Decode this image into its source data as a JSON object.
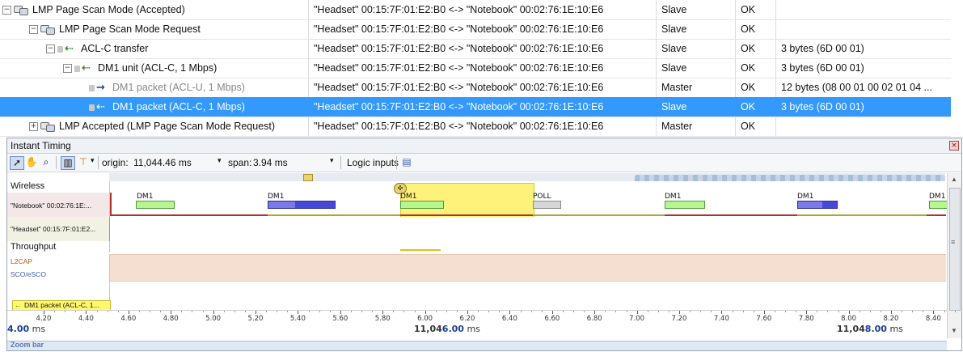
{
  "tree": {
    "rows": [
      {
        "label": "LMP Page Scan Mode (Accepted)",
        "connection": "\"Headset\" 00:15:7F:01:E2:B0 <-> \"Notebook\" 00:02:76:1E:10:E6",
        "role": "Slave",
        "status": "OK",
        "summary": ""
      },
      {
        "label": "LMP Page Scan Mode Request",
        "connection": "\"Headset\" 00:15:7F:01:E2:B0 <-> \"Notebook\" 00:02:76:1E:10:E6",
        "role": "Slave",
        "status": "OK",
        "summary": ""
      },
      {
        "label": "ACL-C transfer",
        "connection": "\"Headset\" 00:15:7F:01:E2:B0 <-> \"Notebook\" 00:02:76:1E:10:E6",
        "role": "Slave",
        "status": "OK",
        "summary": "3 bytes (6D 00 01)"
      },
      {
        "label": "DM1 unit (ACL-C, 1 Mbps)",
        "connection": "\"Headset\" 00:15:7F:01:E2:B0 <-> \"Notebook\" 00:02:76:1E:10:E6",
        "role": "Slave",
        "status": "OK",
        "summary": "3 bytes (6D 00 01)"
      },
      {
        "label": "DM1 packet (ACL-U, 1 Mbps)",
        "connection": "\"Headset\" 00:15:7F:01:E2:B0 <-> \"Notebook\" 00:02:76:1E:10:E6",
        "role": "Master",
        "status": "OK",
        "summary": "12 bytes (08 00 01 00 02 01 04 ..."
      },
      {
        "label": "DM1 packet (ACL-C, 1 Mbps)",
        "connection": "\"Headset\" 00:15:7F:01:E2:B0 <-> \"Notebook\" 00:02:76:1E:10:E6",
        "role": "Slave",
        "status": "OK",
        "summary": "3 bytes (6D 00 01)"
      },
      {
        "label": "LMP Accepted (LMP Page Scan Mode Request)",
        "connection": "\"Headset\" 00:15:7F:01:E2:B0 <-> \"Notebook\" 00:02:76:1E:10:E6",
        "role": "Master",
        "status": "OK",
        "summary": ""
      }
    ]
  },
  "timing": {
    "title": "Instant Timing",
    "origin_label": "origin:",
    "origin_value": "11,044.46 ms",
    "span_label": "span:",
    "span_value": "3.94 ms",
    "logic_inputs": "Logic inputs",
    "lanes": {
      "wireless": "Wireless",
      "notebook": "\"Notebook\" 00:02:76:1E:...",
      "headset": "\"Headset\" 00:15:7F:01:E2...",
      "throughput": "Throughput",
      "l2cap": "L2CAP",
      "sco": "SCO/eSCO",
      "selected": "DM1 packet (ACL-C, 1..."
    },
    "packet_labels": [
      "DM1",
      "DM1",
      "DM1",
      "POLL",
      "DM1",
      "DM1",
      "DM1"
    ],
    "ticks": [
      "4.20",
      "4.40",
      "4.60",
      "4.80",
      "5.00",
      "5.20",
      "5.40",
      "5.60",
      "5.80",
      "6.00",
      "6.20",
      "6.40",
      "6.60",
      "6.80",
      "7.00",
      "7.20",
      "7.40",
      "7.60",
      "7.80",
      "8.00",
      "8.20",
      "8.40"
    ],
    "left_time_prefix": "4.00",
    "left_time_unit": "ms",
    "mid_time_prefix": "11,04",
    "mid_time_bold": "6.00",
    "mid_time_unit": "ms",
    "right_time_prefix": "11,04",
    "right_time_bold": "8.00",
    "right_time_unit": "ms",
    "zoom_bar": "Zoom bar"
  },
  "colors": {
    "selection": "#3399ff",
    "master_line": "#b03030",
    "slave_line": "#a8a832",
    "highlight": "#fff27a"
  }
}
